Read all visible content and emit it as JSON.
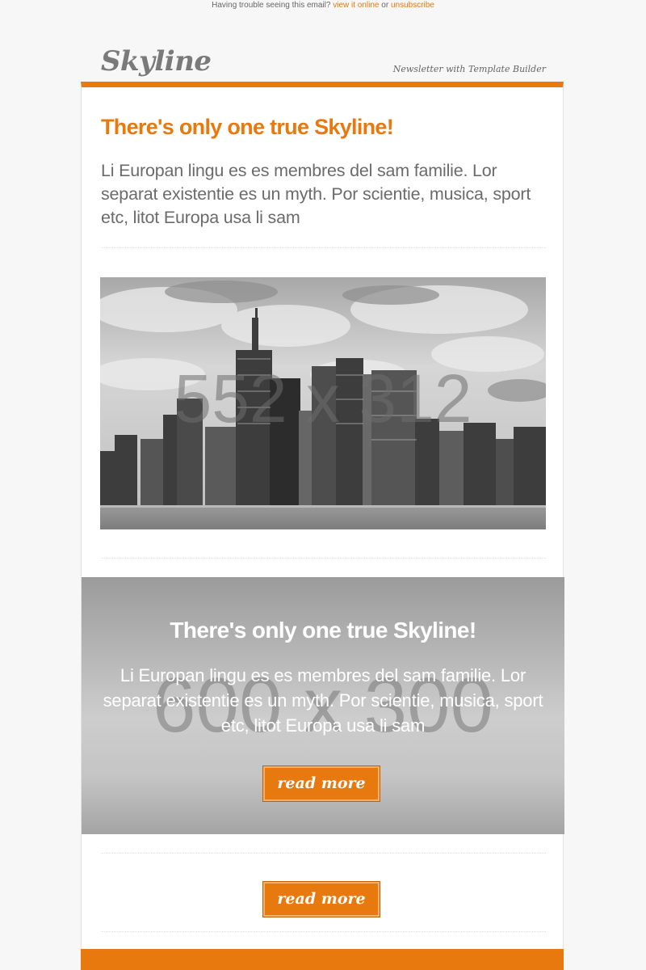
{
  "preheader": {
    "text": "Having trouble seeing this email?",
    "view_online": "view it online",
    "or": "or",
    "unsubscribe": "unsubscribe"
  },
  "header": {
    "logo": "Skyline",
    "tagline": "Newsletter with Template Builder"
  },
  "article": {
    "headline": "There's only one true Skyline!",
    "intro": "Li Europan lingu es es membres del sam familie. Lor separat existentie es un myth. Por scientie, musica, sport etc, litot Europa usa li sam",
    "image_label": "552 x 312"
  },
  "hero": {
    "bg_label": "600 x 300",
    "title": "There's only one true Skyline!",
    "text": "Li Europan lingu es es membres del sam familie. Lor separat existentie es un myth. Por scientie, musica, sport etc, litot Europa usa li sam",
    "button_label": "read more"
  },
  "cta": {
    "button_label": "read more"
  },
  "colors": {
    "accent": "#e8790f",
    "text": "#6b6b6b",
    "background": "#f7f7f7"
  }
}
